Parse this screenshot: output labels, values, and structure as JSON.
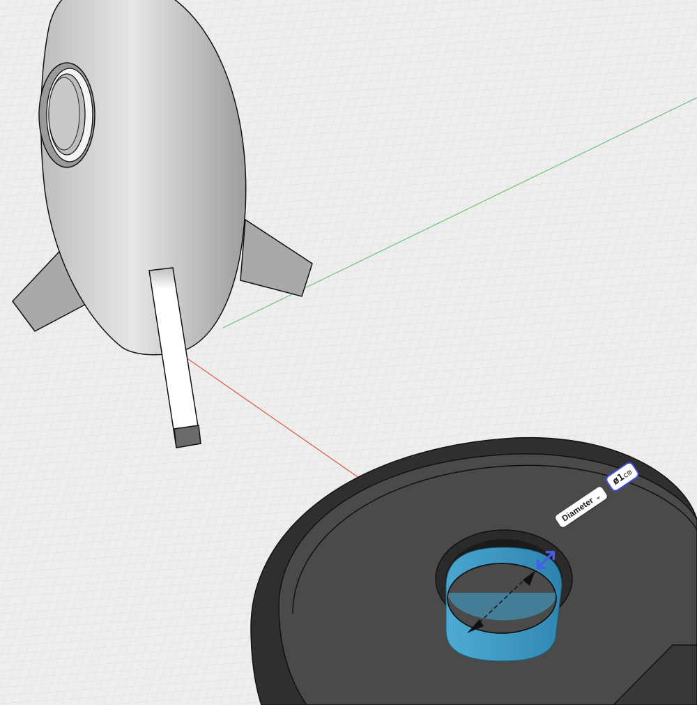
{
  "dimension": {
    "type_label": "Diameter",
    "type_chevron": "⌄",
    "value": "ø1",
    "unit": "cm"
  },
  "colors": {
    "background": "#eeeeee",
    "grid_line": "#d9d9d9",
    "axis_x": "#e0604a",
    "axis_y": "#7ec48a",
    "rocket_body": "#d6d6d6",
    "base_dark": "#3c3c3c",
    "hole_highlight": "#3ea7d6",
    "handle_accent": "#4a5be8"
  },
  "icons": {
    "resize_handle": "double-arrow-icon"
  }
}
